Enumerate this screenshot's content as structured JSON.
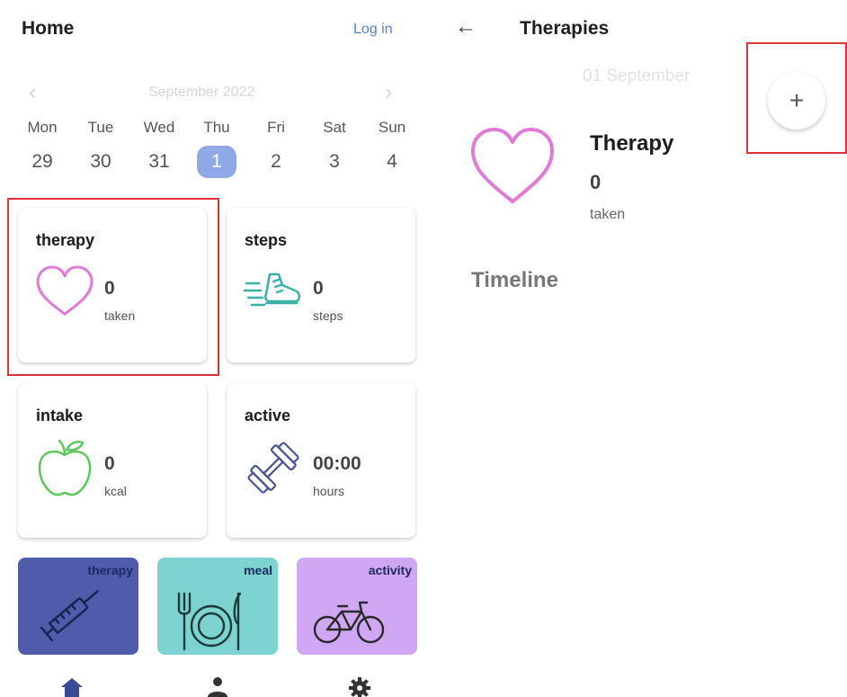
{
  "home": {
    "title": "Home",
    "login_label": "Log in",
    "month_label": "September 2022",
    "days": [
      {
        "name": "Mon",
        "date": "29"
      },
      {
        "name": "Tue",
        "date": "30"
      },
      {
        "name": "Wed",
        "date": "31"
      },
      {
        "name": "Thu",
        "date": "1",
        "selected": true
      },
      {
        "name": "Fri",
        "date": "2"
      },
      {
        "name": "Sat",
        "date": "3"
      },
      {
        "name": "Sun",
        "date": "4"
      }
    ],
    "cards": {
      "therapy": {
        "title": "therapy",
        "value": "0",
        "unit": "taken",
        "icon": "heart-icon"
      },
      "steps": {
        "title": "steps",
        "value": "0",
        "unit": "steps",
        "icon": "running-shoe-icon"
      },
      "intake": {
        "title": "intake",
        "value": "0",
        "unit": "kcal",
        "icon": "apple-icon"
      },
      "active": {
        "title": "active",
        "value": "00:00",
        "unit": "hours",
        "icon": "dumbbell-icon"
      }
    },
    "tiles": [
      {
        "label": "therapy",
        "icon": "syringe-icon",
        "color": "#4f5bab"
      },
      {
        "label": "meal",
        "icon": "plate-cutlery-icon",
        "color": "#7dd3cf"
      },
      {
        "label": "activity",
        "icon": "bicycle-icon",
        "color": "#cfa7f2"
      }
    ],
    "nav": [
      "home-icon",
      "person-icon",
      "gear-icon"
    ]
  },
  "therapies": {
    "title": "Therapies",
    "date_label": "01 September",
    "add_label": "+",
    "item": {
      "label": "Therapy",
      "value": "0",
      "unit": "taken"
    },
    "timeline_label": "Timeline"
  },
  "colors": {
    "accent": "#5a7fe0",
    "selected_day": "#8ea8e8",
    "heart": "#e07ad6",
    "steps": "#3bb0a8",
    "apple": "#5cc85c",
    "dumbbell": "#4a5296",
    "highlight": "#e0303a"
  }
}
